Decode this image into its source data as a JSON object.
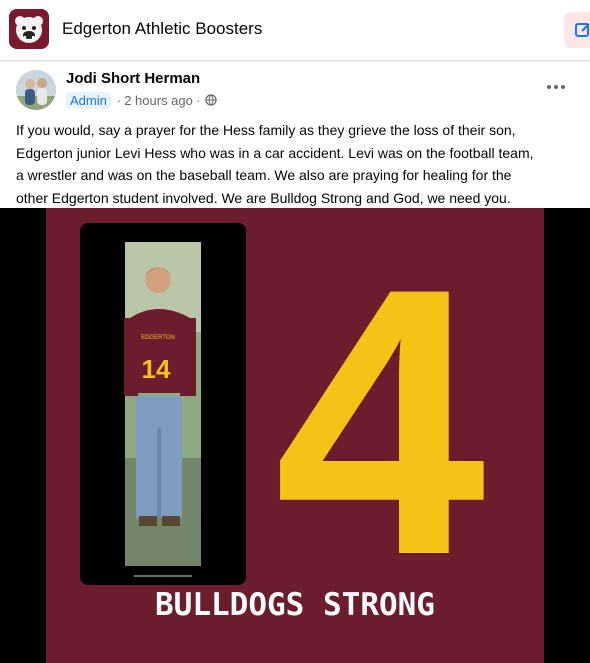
{
  "group": {
    "name": "Edgerton Athletic Boosters",
    "avatar_icon": "bulldog-logo-icon",
    "compose_icon": "edit-icon"
  },
  "post": {
    "author": "Jodi Short Herman",
    "role_badge": "Admin",
    "separator": "·",
    "timestamp": "2 hours ago",
    "privacy_icon": "globe-icon",
    "more_icon": "more-options-icon",
    "text_lines": [
      "If you would, say a prayer for the Hess family as they grieve the loss of their son,",
      "Edgerton junior Levi Hess who was in a car accident.  Levi was on the football team,",
      "a wrestler and was on the baseball team. We also are praying for healing for the",
      "other Edgerton student involved.  We are Bulldog Strong and God, we need you."
    ]
  },
  "image": {
    "jersey_number": "4",
    "jersey_text": "EDGERTON",
    "player_number": "14",
    "caption": "BULLDOGS STRONG"
  },
  "colors": {
    "maroon": "#6b1d2e",
    "gold": "#f3c318",
    "link_blue": "#1877f2"
  }
}
